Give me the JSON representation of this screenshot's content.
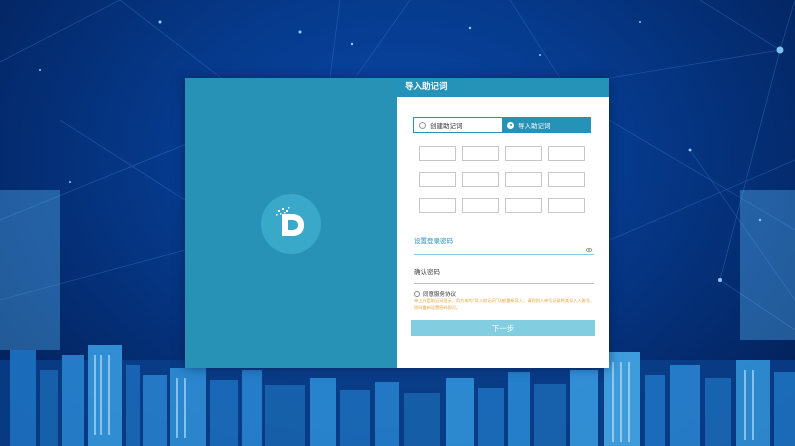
{
  "dialog": {
    "title": "导入助记词",
    "tabs": [
      {
        "label": "创建助记词",
        "active": false
      },
      {
        "label": "导入助记词",
        "active": true
      }
    ],
    "password_label": "设置登录密码",
    "confirm_label": "确认密码",
    "agree_label": "同意服务协议",
    "warning_text": "单上方是助记词显示，用方来的“导入助记词”功能重新导入；请到别人单号记录将其导入入账号，密码重新设置密码即可。",
    "next_label": "下一步",
    "word_slot_count": 12
  },
  "colors": {
    "accent": "#2592b8",
    "left_panel": "#2792b6",
    "button": "#82cde0",
    "warning": "#e8a23a",
    "background": "#063a8c"
  },
  "icons": {
    "logo": "d-logo-icon",
    "password_toggle": "eye-icon"
  }
}
